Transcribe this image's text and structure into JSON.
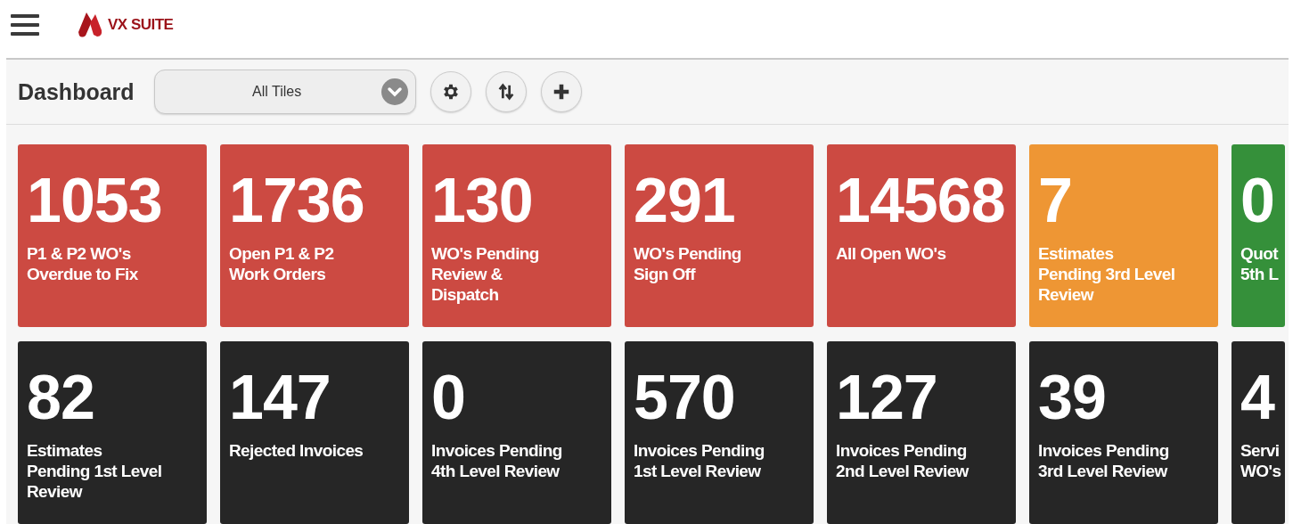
{
  "app": {
    "logo_text": "VX SUITE"
  },
  "toolbar": {
    "title": "Dashboard",
    "filter": {
      "value": "All Tiles"
    }
  },
  "tiles": [
    {
      "value": "1053",
      "label": "P1 & P2 WO's\nOverdue to Fix",
      "color": "#cc4a42"
    },
    {
      "value": "1736",
      "label": "Open P1 & P2\nWork Orders",
      "color": "#cc4a42"
    },
    {
      "value": "130",
      "label": "WO's Pending\nReview &\nDispatch",
      "color": "#cc4a42"
    },
    {
      "value": "291",
      "label": "WO's Pending\nSign Off",
      "color": "#cc4a42"
    },
    {
      "value": "14568",
      "label": "All Open WO's",
      "color": "#cc4a42"
    },
    {
      "value": "7",
      "label": "Estimates\nPending 3rd Level\nReview",
      "color": "#ee9634"
    },
    {
      "value": "0",
      "label": "Quot\n5th L",
      "color": "#35903a"
    },
    {
      "value": "82",
      "label": "Estimates\nPending 1st Level\nReview",
      "color": "#262626"
    },
    {
      "value": "147",
      "label": "Rejected Invoices",
      "color": "#262626"
    },
    {
      "value": "0",
      "label": "Invoices Pending\n4th Level Review",
      "color": "#262626"
    },
    {
      "value": "570",
      "label": "Invoices Pending\n1st Level Review",
      "color": "#262626"
    },
    {
      "value": "127",
      "label": "Invoices Pending\n2nd Level Review",
      "color": "#262626"
    },
    {
      "value": "39",
      "label": "Invoices Pending\n3rd Level Review",
      "color": "#262626"
    },
    {
      "value": "4",
      "label": "Servi\nWO's",
      "color": "#262626"
    }
  ]
}
